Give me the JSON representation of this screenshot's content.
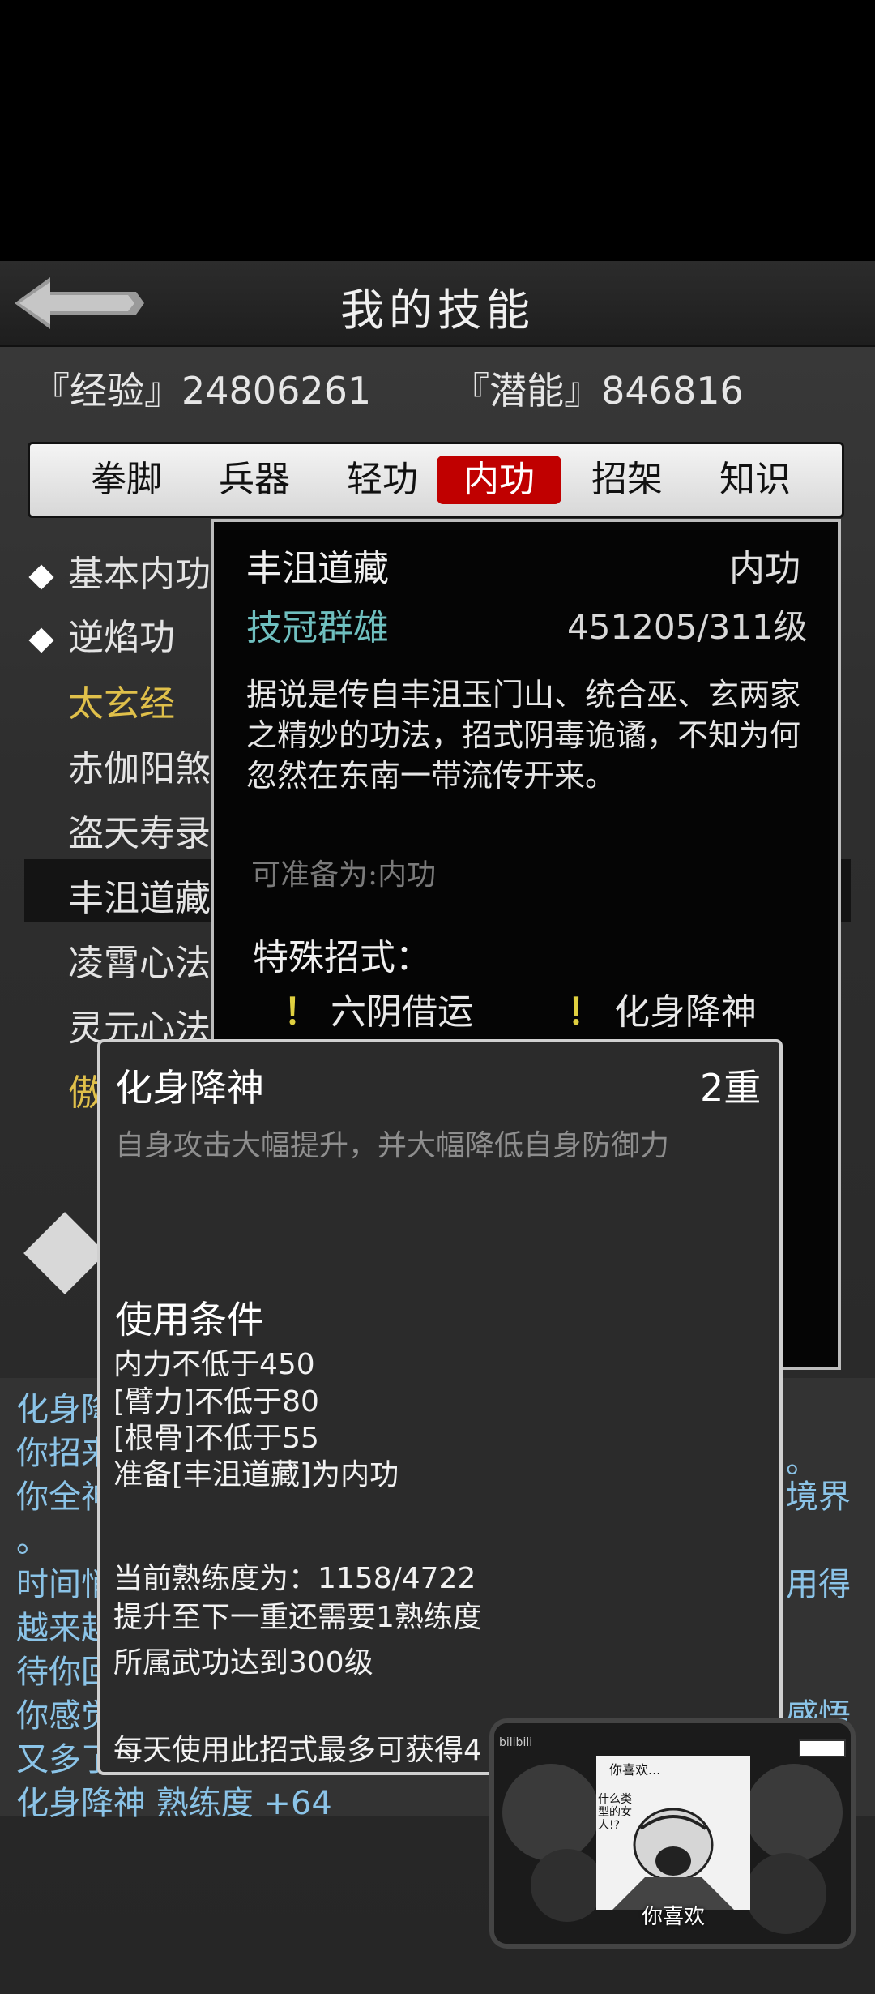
{
  "header": {
    "title": "我的技能",
    "back_icon": "back-arrow-icon"
  },
  "stats": {
    "exp_label": "『经验』24806261",
    "potential_label": "『潜能』846816"
  },
  "tabs": [
    {
      "label": "拳脚",
      "active": false
    },
    {
      "label": "兵器",
      "active": false
    },
    {
      "label": "轻功",
      "active": false
    },
    {
      "label": "内功",
      "active": true
    },
    {
      "label": "招架",
      "active": false
    },
    {
      "label": "知识",
      "active": false
    }
  ],
  "skill_list": [
    {
      "label": "基本内功",
      "marker": "diamond",
      "color": "#e4e4e4"
    },
    {
      "label": "逆焰功",
      "marker": "diamond",
      "color": "#e4e4e4"
    },
    {
      "label": "太玄经",
      "marker": "",
      "color": "#e0c04a"
    },
    {
      "label": "赤伽阳煞",
      "marker": "",
      "color": "#e4e4e4"
    },
    {
      "label": "盗天寿录",
      "marker": "",
      "color": "#e4e4e4"
    },
    {
      "label": "丰沮道藏",
      "marker": "",
      "color": "#e4e4e4"
    },
    {
      "label": "凌霄心法",
      "marker": "",
      "color": "#e4e4e4"
    },
    {
      "label": "灵元心法",
      "marker": "",
      "color": "#e4e4e4"
    },
    {
      "label": "傲",
      "marker": "",
      "color": "#e0c04a"
    }
  ],
  "skill_popup": {
    "name": "丰沮道藏",
    "type": "内功",
    "rank": "技冠群雄",
    "level": "451205/311级",
    "description": "据说是传自丰沮玉门山、统合巫、玄两家之精妙的功法，招式阴毒诡谲，不知为何忽然在东南一带流传开来。",
    "prep": "可准备为:内功",
    "special_title": "特殊招式：",
    "moves": [
      "六阴借运",
      "化身降神"
    ],
    "bang": "！"
  },
  "move_popup": {
    "name": "化身降神",
    "tier": "2重",
    "description": "自身攻击大幅提升，并大幅降低自身防御力",
    "conditions_title": "使用条件",
    "conditions": [
      "内力不低于450",
      "[臂力]不低于80",
      "[根骨]不低于55",
      "准备[丰沮道藏]为内功"
    ],
    "proficiency": [
      "当前熟练度为：1158/4722",
      "提升至下一重还需要1熟练度",
      "所属武功达到300级"
    ],
    "daily": "每天使用此招式最多可获得4"
  },
  "log": {
    "lines_left": [
      "化身降",
      "你招来",
      "你全神",
      "。",
      "时间悄",
      "越来越",
      "待你回",
      "你感觉",
      "又多了"
    ],
    "lines_right": [
      "。",
      "境界",
      "用得",
      "感悟"
    ],
    "last_line": "化身降神 熟练度 +64"
  },
  "video": {
    "caption": "你喜欢",
    "bubble1": "你喜欢...",
    "bubble2": "什么类型的女人!?",
    "logo": "bilibili"
  },
  "colors": {
    "accent_red": "#c00000",
    "rank_teal": "#6fbfbf",
    "log_blue": "#8bc4e8",
    "gold": "#e0c04a"
  }
}
